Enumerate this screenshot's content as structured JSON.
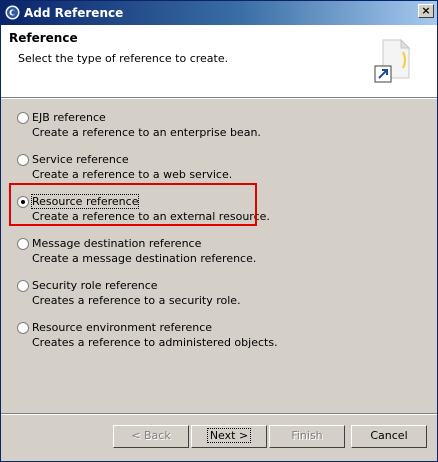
{
  "window": {
    "title": "Add Reference",
    "close_glyph": "×",
    "title_icon": "eclipse-icon"
  },
  "header": {
    "title": "Reference",
    "description": "Select the type of reference to create.",
    "icon": "new-reference-wizard-icon"
  },
  "options": [
    {
      "label": "EJB reference",
      "description": "Create a reference to an enterprise bean.",
      "selected": false
    },
    {
      "label": "Service reference",
      "description": "Create a reference to a web service.",
      "selected": false
    },
    {
      "label": "Resource reference",
      "description": "Create a reference to an external resource.",
      "selected": true
    },
    {
      "label": "Message destination reference",
      "description": "Create a message destination reference.",
      "selected": false
    },
    {
      "label": "Security role reference",
      "description": "Creates a reference to a security role.",
      "selected": false
    },
    {
      "label": "Resource environment reference",
      "description": "Creates a reference to administered objects.",
      "selected": false
    }
  ],
  "buttons": {
    "back": "< Back",
    "next": "Next >",
    "finish": "Finish",
    "cancel": "Cancel"
  },
  "colors": {
    "title_bar": "#0a246a",
    "highlight": "#e00000",
    "dialog_bg": "#d4d0c8"
  }
}
